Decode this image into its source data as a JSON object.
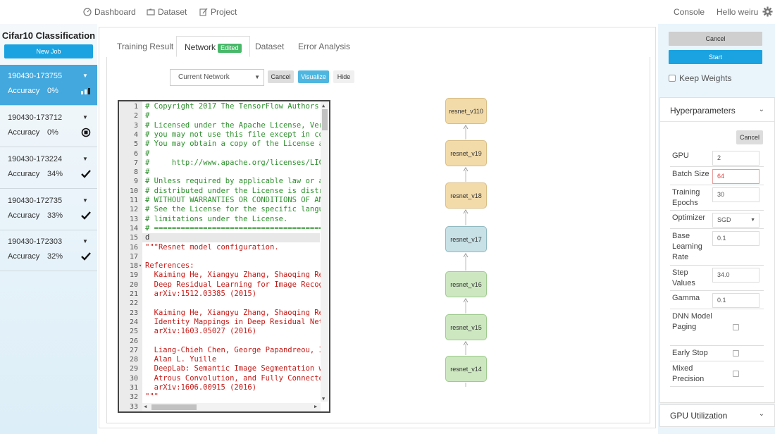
{
  "nav": {
    "dashboard": "Dashboard",
    "dataset": "Dataset",
    "project": "Project",
    "console": "Console",
    "greeting": "Hello weiru"
  },
  "sidebar": {
    "title": "Cifar10 Classification",
    "new_job": "New Job",
    "jobs": [
      {
        "id": "190430-173755",
        "acc_label": "Accuracy",
        "acc": "0%",
        "status": "running-bars-icon"
      },
      {
        "id": "190430-173712",
        "acc_label": "Accuracy",
        "acc": "0%",
        "status": "stop-icon"
      },
      {
        "id": "190430-173224",
        "acc_label": "Accuracy",
        "acc": "34%",
        "status": "check-icon"
      },
      {
        "id": "190430-172735",
        "acc_label": "Accuracy",
        "acc": "33%",
        "status": "check-icon"
      },
      {
        "id": "190430-172303",
        "acc_label": "Accuracy",
        "acc": "32%",
        "status": "check-icon"
      }
    ]
  },
  "tabs": {
    "training_result": "Training Result",
    "network": "Network",
    "network_badge": "Edited",
    "dataset": "Dataset",
    "error_analysis": "Error Analysis"
  },
  "network_toolbar": {
    "select_value": "Current Network",
    "cancel": "Cancel",
    "visualize": "Visualize",
    "hide": "Hide"
  },
  "code_lines": [
    {
      "n": "1",
      "t": "# Copyright 2017 The TensorFlow Authors.",
      "c": "green"
    },
    {
      "n": "2",
      "t": "#",
      "c": "green"
    },
    {
      "n": "3",
      "t": "# Licensed under the Apache License, Vers",
      "c": "green"
    },
    {
      "n": "4",
      "t": "# you may not use this file except in com",
      "c": "green"
    },
    {
      "n": "5",
      "t": "# You may obtain a copy of the License at",
      "c": "green"
    },
    {
      "n": "6",
      "t": "#",
      "c": "green"
    },
    {
      "n": "7",
      "t": "#     http://www.apache.org/licenses/LICE",
      "c": "green"
    },
    {
      "n": "8",
      "t": "#",
      "c": "green"
    },
    {
      "n": "9",
      "t": "# Unless required by applicable law or ag",
      "c": "green"
    },
    {
      "n": "10",
      "t": "# distributed under the License is distri",
      "c": "green"
    },
    {
      "n": "11",
      "t": "# WITHOUT WARRANTIES OR CONDITIONS OF ANY",
      "c": "green"
    },
    {
      "n": "12",
      "t": "# See the License for the specific langua",
      "c": "green"
    },
    {
      "n": "13",
      "t": "# limitations under the License.",
      "c": "green"
    },
    {
      "n": "14",
      "t": "# ========================================",
      "c": "green"
    },
    {
      "n": "15",
      "t": "d",
      "c": "dark"
    },
    {
      "n": "16",
      "t": "\"\"\"Resnet model configuration.",
      "c": "red"
    },
    {
      "n": "17",
      "t": "",
      "c": "red"
    },
    {
      "n": "18",
      "t": "References:",
      "c": "red"
    },
    {
      "n": "19",
      "t": "  Kaiming He, Xiangyu Zhang, Shaoqing Ren",
      "c": "red"
    },
    {
      "n": "20",
      "t": "  Deep Residual Learning for Image Recogn",
      "c": "red"
    },
    {
      "n": "21",
      "t": "  arXiv:1512.03385 (2015)",
      "c": "red"
    },
    {
      "n": "22",
      "t": "",
      "c": "red"
    },
    {
      "n": "23",
      "t": "  Kaiming He, Xiangyu Zhang, Shaoqing Ren",
      "c": "red"
    },
    {
      "n": "24",
      "t": "  Identity Mappings in Deep Residual Netw",
      "c": "red"
    },
    {
      "n": "25",
      "t": "  arXiv:1603.05027 (2016)",
      "c": "red"
    },
    {
      "n": "26",
      "t": "",
      "c": "red"
    },
    {
      "n": "27",
      "t": "  Liang-Chieh Chen, George Papandreou, Ia",
      "c": "red"
    },
    {
      "n": "28",
      "t": "  Alan L. Yuille",
      "c": "red"
    },
    {
      "n": "29",
      "t": "  DeepLab: Semantic Image Segmentation wi",
      "c": "red"
    },
    {
      "n": "30",
      "t": "  Atrous Convolution, and Fully Connected",
      "c": "red"
    },
    {
      "n": "31",
      "t": "  arXiv:1606.00915 (2016)",
      "c": "red"
    },
    {
      "n": "32",
      "t": "\"\"\"",
      "c": "red"
    },
    {
      "n": "33",
      "t": "",
      "c": "dark"
    }
  ],
  "diagram_nodes": [
    {
      "label": "resnet_v110",
      "color": "#f3dba9",
      "border": "#d8bd85"
    },
    {
      "label": "resnet_v19",
      "color": "#f3dba9",
      "border": "#d8bd85"
    },
    {
      "label": "resnet_v18",
      "color": "#f3dba9",
      "border": "#d8bd85"
    },
    {
      "label": "resnet_v17",
      "color": "#c7e1e6",
      "border": "#8fb9c2"
    },
    {
      "label": "resnet_v16",
      "color": "#cde8c1",
      "border": "#9fca8e"
    },
    {
      "label": "resnet_v15",
      "color": "#cde8c1",
      "border": "#9fca8e"
    },
    {
      "label": "resnet_v14",
      "color": "#cde8c1",
      "border": "#9fca8e"
    }
  ],
  "right": {
    "cancel": "Cancel",
    "start": "Start",
    "keep_weights": "Keep Weights",
    "hyperparameters": "Hyperparameters",
    "hp_cancel": "Cancel",
    "gpu_util": "GPU Utilization"
  },
  "hyperparams": [
    {
      "label": "GPU",
      "value": "2",
      "type": "input"
    },
    {
      "label": "Batch Size",
      "value": "64",
      "type": "input-error"
    },
    {
      "label": "Training Epochs",
      "value": "30",
      "type": "input"
    },
    {
      "label": "Optimizer",
      "value": "SGD",
      "type": "select"
    },
    {
      "label": "Base Learning Rate",
      "value": "0.1",
      "type": "input"
    },
    {
      "label": "Step Values",
      "value": "34.0",
      "type": "input"
    },
    {
      "label": "Gamma",
      "value": "0.1",
      "type": "input"
    },
    {
      "label": "DNN Model Paging",
      "value": "",
      "type": "checkbox"
    },
    {
      "label": "Early Stop",
      "value": "",
      "type": "checkbox"
    },
    {
      "label": "Mixed Precision",
      "value": "",
      "type": "checkbox"
    }
  ],
  "colors": {
    "accent": "#1aa3e0",
    "active_job": "#42a8de",
    "badge": "#49b86a",
    "error_border": "#e8a0a0"
  }
}
